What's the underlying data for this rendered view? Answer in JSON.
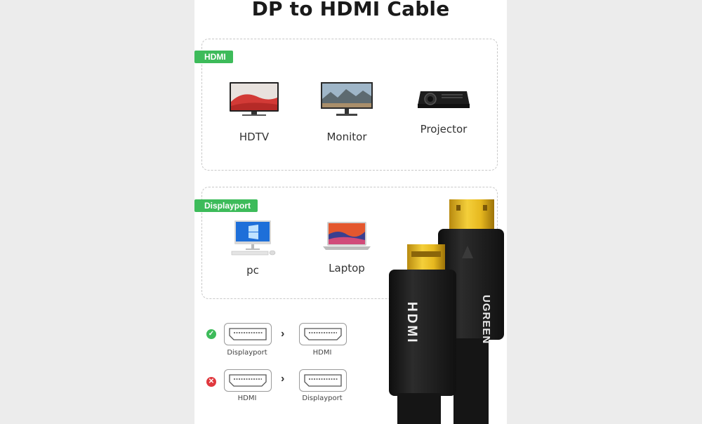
{
  "title": "DP to HDMI Cable",
  "hdmi_section": {
    "tag": "HDMI",
    "devices": [
      {
        "label": "HDTV",
        "icon": "tv-icon"
      },
      {
        "label": "Monitor",
        "icon": "monitor-icon"
      },
      {
        "label": "Projector",
        "icon": "projector-icon"
      }
    ]
  },
  "dp_section": {
    "tag": "Displayport",
    "devices": [
      {
        "label": "pc",
        "icon": "desktop-pc-icon"
      },
      {
        "label": "Laptop",
        "icon": "laptop-icon"
      }
    ]
  },
  "compatibility": {
    "supported": {
      "from": "Displayport",
      "to": "HDMI",
      "status_color": "#3dbb5a"
    },
    "unsupported": {
      "from": "HDMI",
      "to": "Displayport",
      "status_color": "#e0383e"
    }
  },
  "cable": {
    "brand": "UGREEN",
    "connector_logo": "HDMI"
  },
  "colors": {
    "accent": "#3dbb5a",
    "background": "#ececec"
  }
}
